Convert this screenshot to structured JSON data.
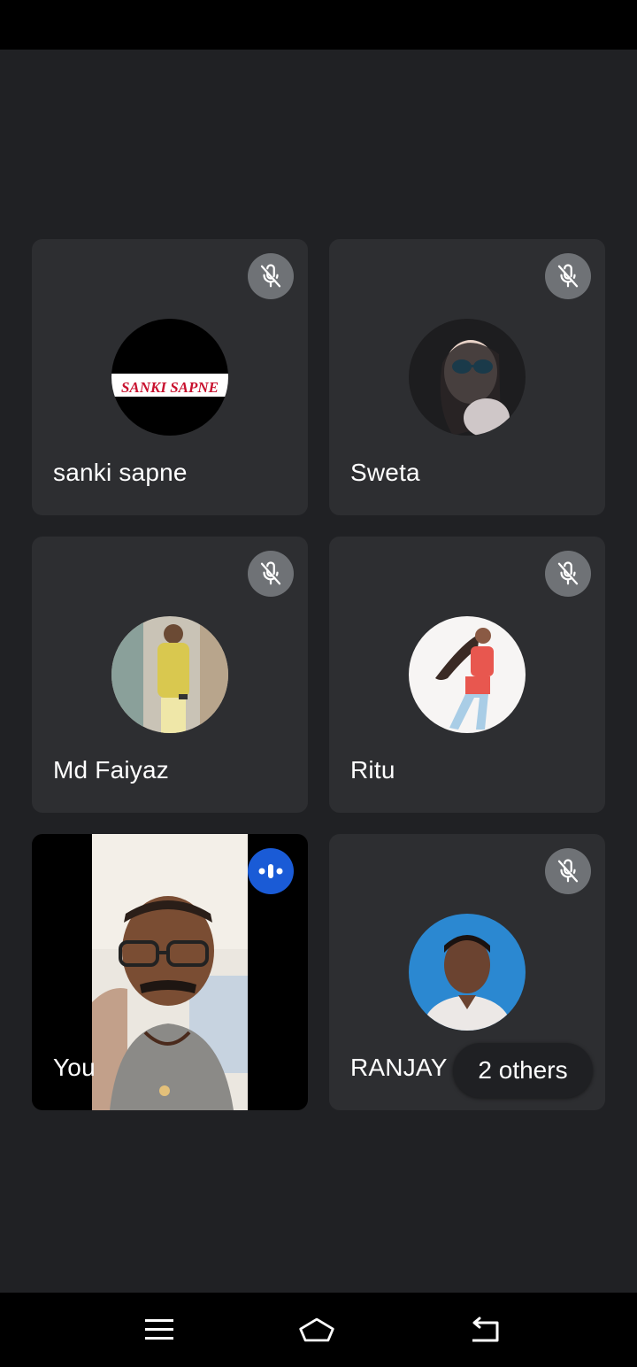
{
  "participants": [
    {
      "name": "sanki sapne",
      "muted": true,
      "avatar_text": "SANKI SAPNE"
    },
    {
      "name": "Sweta",
      "muted": true
    },
    {
      "name": "Md Faiyaz",
      "muted": true
    },
    {
      "name": "Ritu",
      "muted": true
    },
    {
      "name": "You",
      "speaking": true
    },
    {
      "name": "RANJAY",
      "muted": true
    }
  ],
  "others_label": "2 others",
  "colors": {
    "background": "#202124",
    "tile": "#2d2e31",
    "mic_badge": "#6f7276",
    "speaking_badge": "#1a5bd6"
  },
  "nav": {
    "menu_icon": "menu-icon",
    "home_icon": "home-icon",
    "back_icon": "back-icon"
  }
}
